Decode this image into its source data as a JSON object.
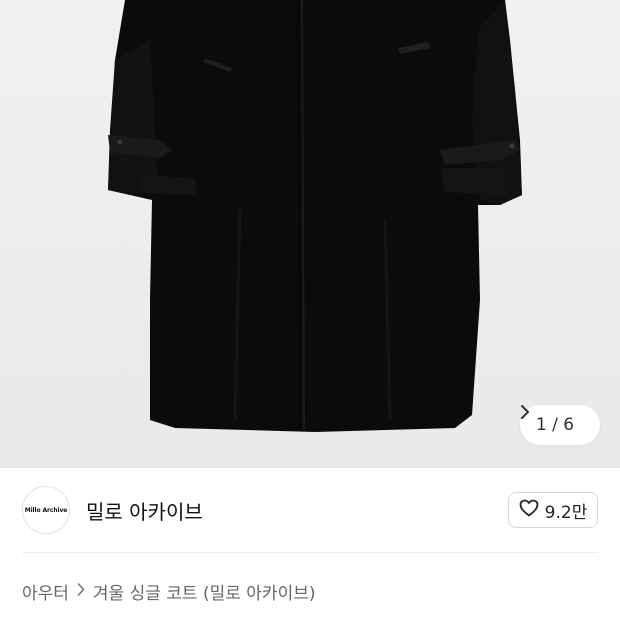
{
  "gallery": {
    "counter_current": "1",
    "counter_separator": "/",
    "counter_total": "6",
    "next_icon": "chevron-right-icon",
    "background_color": "#efefef",
    "garment_color": "#0a0a0a"
  },
  "seller": {
    "logo_text": "Millo Archive",
    "name": "밀로 아카이브",
    "like_icon": "heart-outline-icon",
    "like_count": "9.2만"
  },
  "breadcrumb": {
    "category": "아우터",
    "separator_icon": "chevron-right-icon",
    "product_title": "겨울 싱글 코트 (밀로 아카이브)"
  }
}
